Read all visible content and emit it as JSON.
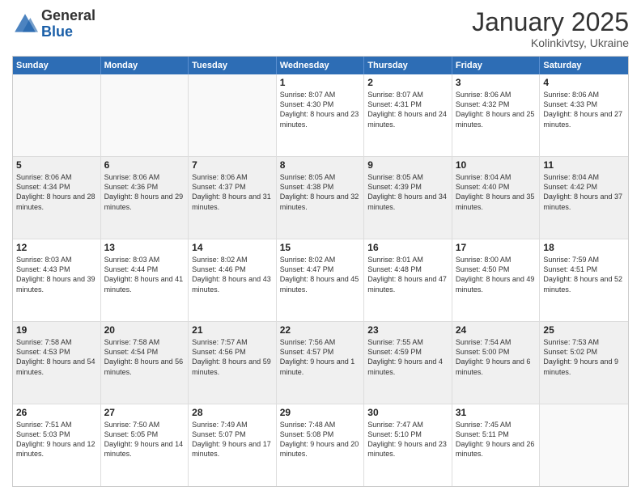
{
  "logo": {
    "general": "General",
    "blue": "Blue"
  },
  "header": {
    "month": "January 2025",
    "location": "Kolinkivtsy, Ukraine"
  },
  "weekdays": [
    "Sunday",
    "Monday",
    "Tuesday",
    "Wednesday",
    "Thursday",
    "Friday",
    "Saturday"
  ],
  "rows": [
    [
      {
        "day": "",
        "text": ""
      },
      {
        "day": "",
        "text": ""
      },
      {
        "day": "",
        "text": ""
      },
      {
        "day": "1",
        "text": "Sunrise: 8:07 AM\nSunset: 4:30 PM\nDaylight: 8 hours and 23 minutes."
      },
      {
        "day": "2",
        "text": "Sunrise: 8:07 AM\nSunset: 4:31 PM\nDaylight: 8 hours and 24 minutes."
      },
      {
        "day": "3",
        "text": "Sunrise: 8:06 AM\nSunset: 4:32 PM\nDaylight: 8 hours and 25 minutes."
      },
      {
        "day": "4",
        "text": "Sunrise: 8:06 AM\nSunset: 4:33 PM\nDaylight: 8 hours and 27 minutes."
      }
    ],
    [
      {
        "day": "5",
        "text": "Sunrise: 8:06 AM\nSunset: 4:34 PM\nDaylight: 8 hours and 28 minutes."
      },
      {
        "day": "6",
        "text": "Sunrise: 8:06 AM\nSunset: 4:36 PM\nDaylight: 8 hours and 29 minutes."
      },
      {
        "day": "7",
        "text": "Sunrise: 8:06 AM\nSunset: 4:37 PM\nDaylight: 8 hours and 31 minutes."
      },
      {
        "day": "8",
        "text": "Sunrise: 8:05 AM\nSunset: 4:38 PM\nDaylight: 8 hours and 32 minutes."
      },
      {
        "day": "9",
        "text": "Sunrise: 8:05 AM\nSunset: 4:39 PM\nDaylight: 8 hours and 34 minutes."
      },
      {
        "day": "10",
        "text": "Sunrise: 8:04 AM\nSunset: 4:40 PM\nDaylight: 8 hours and 35 minutes."
      },
      {
        "day": "11",
        "text": "Sunrise: 8:04 AM\nSunset: 4:42 PM\nDaylight: 8 hours and 37 minutes."
      }
    ],
    [
      {
        "day": "12",
        "text": "Sunrise: 8:03 AM\nSunset: 4:43 PM\nDaylight: 8 hours and 39 minutes."
      },
      {
        "day": "13",
        "text": "Sunrise: 8:03 AM\nSunset: 4:44 PM\nDaylight: 8 hours and 41 minutes."
      },
      {
        "day": "14",
        "text": "Sunrise: 8:02 AM\nSunset: 4:46 PM\nDaylight: 8 hours and 43 minutes."
      },
      {
        "day": "15",
        "text": "Sunrise: 8:02 AM\nSunset: 4:47 PM\nDaylight: 8 hours and 45 minutes."
      },
      {
        "day": "16",
        "text": "Sunrise: 8:01 AM\nSunset: 4:48 PM\nDaylight: 8 hours and 47 minutes."
      },
      {
        "day": "17",
        "text": "Sunrise: 8:00 AM\nSunset: 4:50 PM\nDaylight: 8 hours and 49 minutes."
      },
      {
        "day": "18",
        "text": "Sunrise: 7:59 AM\nSunset: 4:51 PM\nDaylight: 8 hours and 52 minutes."
      }
    ],
    [
      {
        "day": "19",
        "text": "Sunrise: 7:58 AM\nSunset: 4:53 PM\nDaylight: 8 hours and 54 minutes."
      },
      {
        "day": "20",
        "text": "Sunrise: 7:58 AM\nSunset: 4:54 PM\nDaylight: 8 hours and 56 minutes."
      },
      {
        "day": "21",
        "text": "Sunrise: 7:57 AM\nSunset: 4:56 PM\nDaylight: 8 hours and 59 minutes."
      },
      {
        "day": "22",
        "text": "Sunrise: 7:56 AM\nSunset: 4:57 PM\nDaylight: 9 hours and 1 minute."
      },
      {
        "day": "23",
        "text": "Sunrise: 7:55 AM\nSunset: 4:59 PM\nDaylight: 9 hours and 4 minutes."
      },
      {
        "day": "24",
        "text": "Sunrise: 7:54 AM\nSunset: 5:00 PM\nDaylight: 9 hours and 6 minutes."
      },
      {
        "day": "25",
        "text": "Sunrise: 7:53 AM\nSunset: 5:02 PM\nDaylight: 9 hours and 9 minutes."
      }
    ],
    [
      {
        "day": "26",
        "text": "Sunrise: 7:51 AM\nSunset: 5:03 PM\nDaylight: 9 hours and 12 minutes."
      },
      {
        "day": "27",
        "text": "Sunrise: 7:50 AM\nSunset: 5:05 PM\nDaylight: 9 hours and 14 minutes."
      },
      {
        "day": "28",
        "text": "Sunrise: 7:49 AM\nSunset: 5:07 PM\nDaylight: 9 hours and 17 minutes."
      },
      {
        "day": "29",
        "text": "Sunrise: 7:48 AM\nSunset: 5:08 PM\nDaylight: 9 hours and 20 minutes."
      },
      {
        "day": "30",
        "text": "Sunrise: 7:47 AM\nSunset: 5:10 PM\nDaylight: 9 hours and 23 minutes."
      },
      {
        "day": "31",
        "text": "Sunrise: 7:45 AM\nSunset: 5:11 PM\nDaylight: 9 hours and 26 minutes."
      },
      {
        "day": "",
        "text": ""
      }
    ]
  ]
}
